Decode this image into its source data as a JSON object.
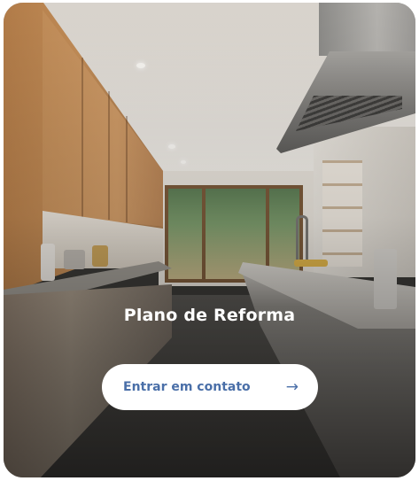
{
  "card": {
    "title": "Plano de Reforma",
    "cta_label": "Entrar em contato",
    "cta_icon": "arrow-right-icon",
    "accent_color": "#4a6fa8",
    "image_subject": "modern-kitchen-photo"
  }
}
